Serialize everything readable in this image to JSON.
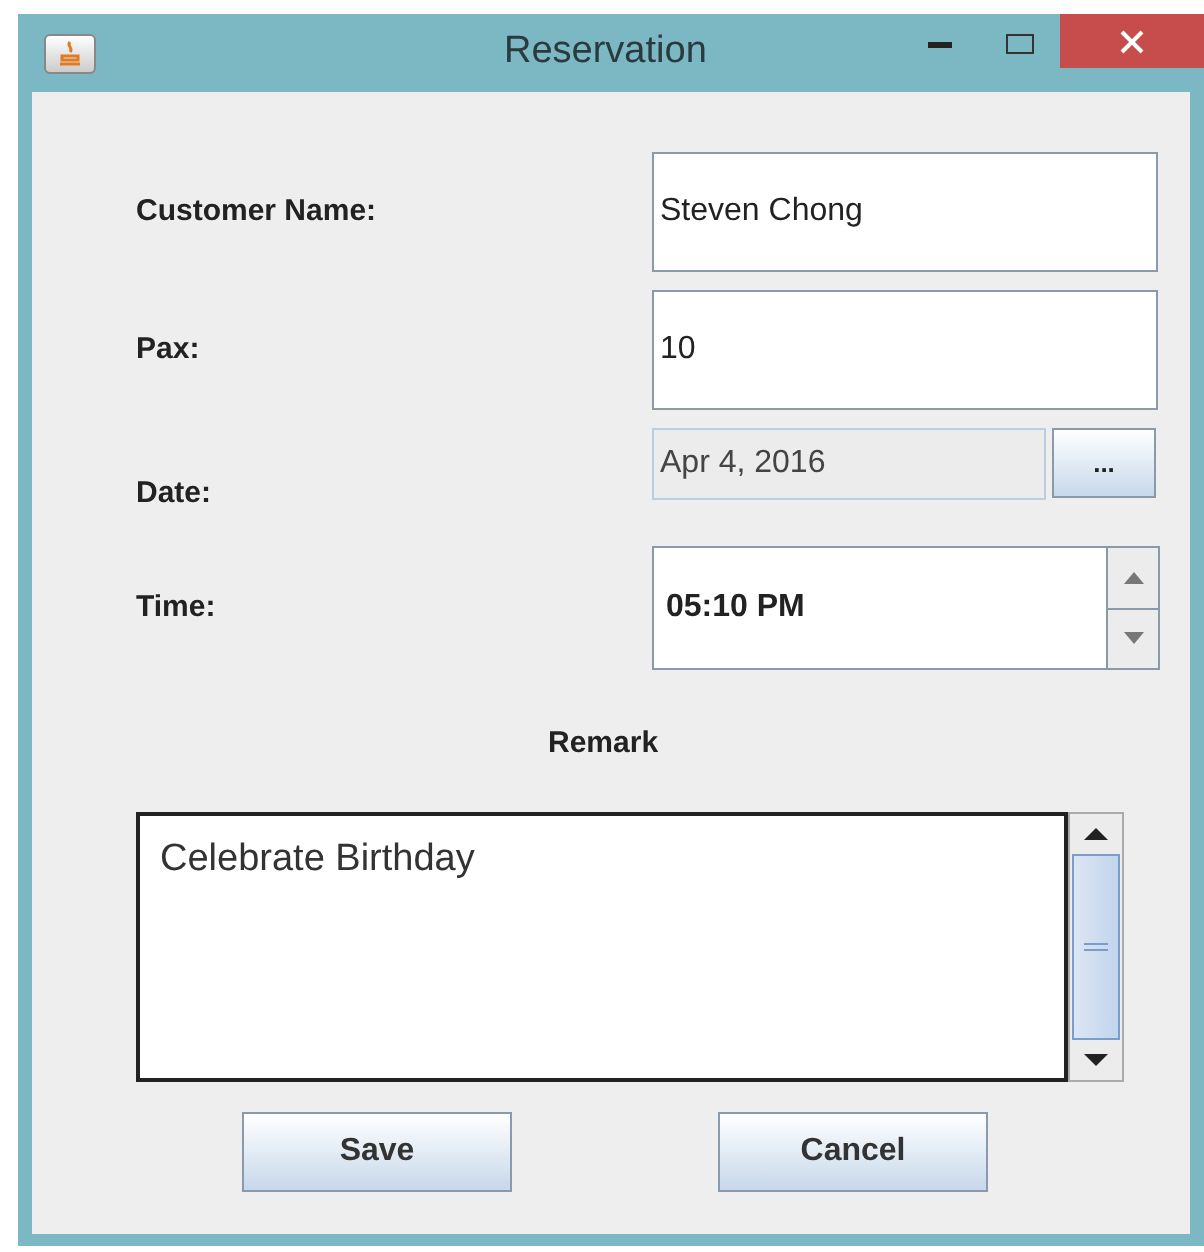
{
  "window": {
    "title": "Reservation"
  },
  "fields": [
    {
      "kind": "text",
      "label": "Customer Name:",
      "value": "Steven Chong"
    },
    {
      "kind": "text",
      "label": "Pax:",
      "value": "10"
    },
    {
      "kind": "date",
      "label": "Date:",
      "value": "Apr 4, 2016",
      "button": "..."
    },
    {
      "kind": "spinner",
      "label": "Time:",
      "value": "05:10 PM"
    }
  ],
  "remark": {
    "label": "Remark",
    "value": "Celebrate Birthday"
  },
  "buttons": [
    "Save",
    "Cancel"
  ]
}
